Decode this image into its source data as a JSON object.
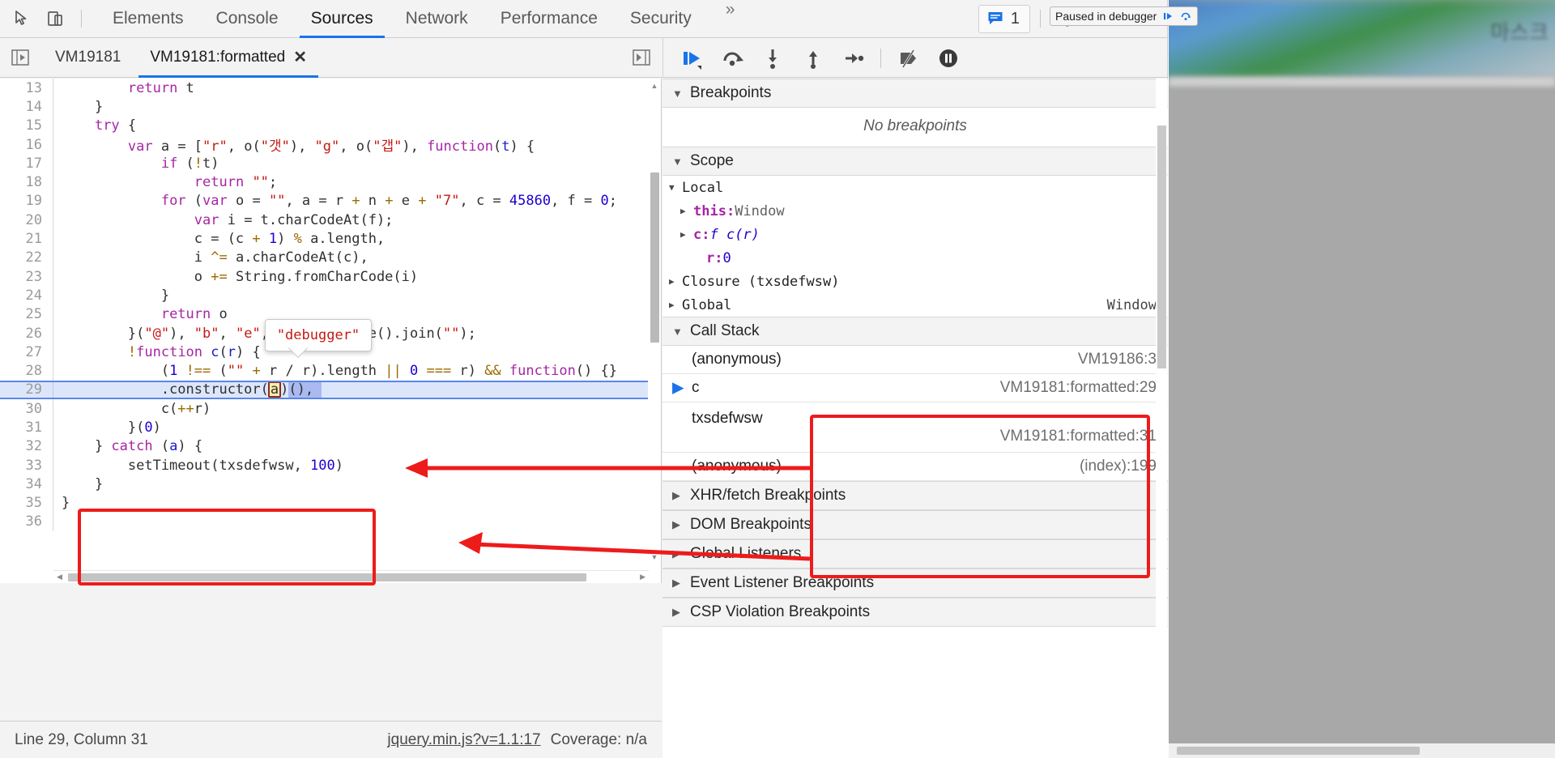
{
  "toolbar": {
    "icons": {
      "inspect": "inspect-cursor-icon",
      "device": "device-toggle-icon"
    },
    "tabs": [
      {
        "label": "Elements",
        "active": false
      },
      {
        "label": "Console",
        "active": false
      },
      {
        "label": "Sources",
        "active": true
      },
      {
        "label": "Network",
        "active": false
      },
      {
        "label": "Performance",
        "active": false
      },
      {
        "label": "Security",
        "active": false
      }
    ],
    "overflow_label": "»",
    "message_count": "1",
    "settings_icon": "gear-icon",
    "more_icon": "kebab-menu-icon",
    "close_icon": "close-icon"
  },
  "sources": {
    "file_tabs": [
      {
        "label": "VM19181",
        "active": false,
        "closable": false
      },
      {
        "label": "VM19181:formatted",
        "active": true,
        "closable": true,
        "close_label": "✕"
      }
    ],
    "debugger_buttons": [
      {
        "name": "resume-script-execution",
        "title": "Resume script execution"
      },
      {
        "name": "step-over-next-function-call",
        "title": "Step over next function call"
      },
      {
        "name": "step-into-next-function-call",
        "title": "Step into next function call"
      },
      {
        "name": "step-out-of-current-function",
        "title": "Step out of current function"
      },
      {
        "name": "step",
        "title": "Step"
      },
      {
        "name": "deactivate-breakpoints",
        "title": "Deactivate breakpoints"
      },
      {
        "name": "pause-on-exceptions",
        "title": "Pause on exceptions"
      }
    ]
  },
  "editor": {
    "highlighted_line": 29,
    "tooltip_text": "\"debugger\"",
    "lines": [
      {
        "n": "13",
        "tokens": [
          {
            "t": "plain",
            "v": "        "
          },
          {
            "t": "kw",
            "v": "return"
          },
          {
            "t": "plain",
            "v": " t"
          }
        ]
      },
      {
        "n": "14",
        "tokens": [
          {
            "t": "plain",
            "v": "    }"
          }
        ]
      },
      {
        "n": "15",
        "tokens": [
          {
            "t": "plain",
            "v": "    "
          },
          {
            "t": "kw",
            "v": "try"
          },
          {
            "t": "plain",
            "v": " {"
          }
        ]
      },
      {
        "n": "16",
        "tokens": [
          {
            "t": "plain",
            "v": "        "
          },
          {
            "t": "kw",
            "v": "var"
          },
          {
            "t": "plain",
            "v": " a = ["
          },
          {
            "t": "str",
            "v": "\"r\""
          },
          {
            "t": "plain",
            "v": ", o("
          },
          {
            "t": "str",
            "v": "\"갯\""
          },
          {
            "t": "plain",
            "v": "), "
          },
          {
            "t": "str",
            "v": "\"g\""
          },
          {
            "t": "plain",
            "v": ", o("
          },
          {
            "t": "str",
            "v": "\"갭\""
          },
          {
            "t": "plain",
            "v": "), "
          },
          {
            "t": "kw",
            "v": "function"
          },
          {
            "t": "plain",
            "v": "("
          },
          {
            "t": "id",
            "v": "t"
          },
          {
            "t": "plain",
            "v": ") {"
          }
        ]
      },
      {
        "n": "17",
        "tokens": [
          {
            "t": "plain",
            "v": "            "
          },
          {
            "t": "kw",
            "v": "if"
          },
          {
            "t": "plain",
            "v": " ("
          },
          {
            "t": "op",
            "v": "!"
          },
          {
            "t": "plain",
            "v": "t)"
          }
        ]
      },
      {
        "n": "18",
        "tokens": [
          {
            "t": "plain",
            "v": "                "
          },
          {
            "t": "kw",
            "v": "return"
          },
          {
            "t": "plain",
            "v": " "
          },
          {
            "t": "str",
            "v": "\"\""
          },
          {
            "t": "plain",
            "v": ";"
          }
        ]
      },
      {
        "n": "19",
        "tokens": [
          {
            "t": "plain",
            "v": "            "
          },
          {
            "t": "kw",
            "v": "for"
          },
          {
            "t": "plain",
            "v": " ("
          },
          {
            "t": "kw",
            "v": "var"
          },
          {
            "t": "plain",
            "v": " o = "
          },
          {
            "t": "str",
            "v": "\"\""
          },
          {
            "t": "plain",
            "v": ", a = r "
          },
          {
            "t": "op",
            "v": "+"
          },
          {
            "t": "plain",
            "v": " n "
          },
          {
            "t": "op",
            "v": "+"
          },
          {
            "t": "plain",
            "v": " e "
          },
          {
            "t": "op",
            "v": "+"
          },
          {
            "t": "plain",
            "v": " "
          },
          {
            "t": "str",
            "v": "\"7\""
          },
          {
            "t": "plain",
            "v": ", c = "
          },
          {
            "t": "num",
            "v": "45860"
          },
          {
            "t": "plain",
            "v": ", f = "
          },
          {
            "t": "num",
            "v": "0"
          },
          {
            "t": "plain",
            "v": ";"
          }
        ]
      },
      {
        "n": "20",
        "tokens": [
          {
            "t": "plain",
            "v": "                "
          },
          {
            "t": "kw",
            "v": "var"
          },
          {
            "t": "plain",
            "v": " i = t.charCodeAt(f);"
          }
        ]
      },
      {
        "n": "21",
        "tokens": [
          {
            "t": "plain",
            "v": "                c = (c "
          },
          {
            "t": "op",
            "v": "+"
          },
          {
            "t": "plain",
            "v": " "
          },
          {
            "t": "num",
            "v": "1"
          },
          {
            "t": "plain",
            "v": ") "
          },
          {
            "t": "op",
            "v": "%"
          },
          {
            "t": "plain",
            "v": " a.length,"
          }
        ]
      },
      {
        "n": "22",
        "tokens": [
          {
            "t": "plain",
            "v": "                i "
          },
          {
            "t": "op",
            "v": "^="
          },
          {
            "t": "plain",
            "v": " a.charCodeAt(c),"
          }
        ]
      },
      {
        "n": "23",
        "tokens": [
          {
            "t": "plain",
            "v": "                o "
          },
          {
            "t": "op",
            "v": "+="
          },
          {
            "t": "plain",
            "v": " String.fromCharCode(i)"
          }
        ]
      },
      {
        "n": "24",
        "tokens": [
          {
            "t": "plain",
            "v": "            }"
          }
        ]
      },
      {
        "n": "25",
        "tokens": [
          {
            "t": "plain",
            "v": "            "
          },
          {
            "t": "kw",
            "v": "return"
          },
          {
            "t": "plain",
            "v": " o"
          }
        ]
      },
      {
        "n": "26",
        "tokens": [
          {
            "t": "plain",
            "v": "        }("
          },
          {
            "t": "str",
            "v": "\"@\""
          },
          {
            "t": "plain",
            "v": "), "
          },
          {
            "t": "str",
            "v": "\"b\""
          },
          {
            "t": "plain",
            "v": ", "
          },
          {
            "t": "str",
            "v": "\"e\""
          },
          {
            "t": "plain",
            "v": ", "
          },
          {
            "t": "str",
            "v": "\"d\""
          },
          {
            "t": "plain",
            "v": "].reverse().join("
          },
          {
            "t": "str",
            "v": "\"\""
          },
          {
            "t": "plain",
            "v": ");"
          }
        ]
      },
      {
        "n": "27",
        "tokens": [
          {
            "t": "plain",
            "v": "        "
          },
          {
            "t": "op",
            "v": "!"
          },
          {
            "t": "kw",
            "v": "function"
          },
          {
            "t": "plain",
            "v": " "
          },
          {
            "t": "id",
            "v": "c"
          },
          {
            "t": "plain",
            "v": "("
          },
          {
            "t": "id",
            "v": "r"
          },
          {
            "t": "plain",
            "v": ") {"
          }
        ]
      },
      {
        "n": "28",
        "tokens": [
          {
            "t": "plain",
            "v": "            ("
          },
          {
            "t": "num",
            "v": "1"
          },
          {
            "t": "plain",
            "v": " "
          },
          {
            "t": "op",
            "v": "!=="
          },
          {
            "t": "plain",
            "v": " ("
          },
          {
            "t": "str",
            "v": "\"\""
          },
          {
            "t": "plain",
            "v": " "
          },
          {
            "t": "op",
            "v": "+"
          },
          {
            "t": "plain",
            "v": " r / r).length "
          },
          {
            "t": "op",
            "v": "||"
          },
          {
            "t": "plain",
            "v": " "
          },
          {
            "t": "num",
            "v": "0"
          },
          {
            "t": "plain",
            "v": " "
          },
          {
            "t": "op",
            "v": "==="
          },
          {
            "t": "plain",
            "v": " r) "
          },
          {
            "t": "op",
            "v": "&&"
          },
          {
            "t": "plain",
            "v": " "
          },
          {
            "t": "kw",
            "v": "function"
          },
          {
            "t": "plain",
            "v": "() {}"
          }
        ]
      },
      {
        "n": "29",
        "tokens": [
          {
            "t": "plain",
            "v": "            .constructor("
          },
          {
            "t": "varbox",
            "v": "a"
          },
          {
            "t": "plain",
            "v": ")"
          },
          {
            "t": "sel",
            "v": "(), "
          }
        ]
      },
      {
        "n": "30",
        "tokens": [
          {
            "t": "plain",
            "v": "            c("
          },
          {
            "t": "op",
            "v": "++"
          },
          {
            "t": "plain",
            "v": "r)"
          }
        ]
      },
      {
        "n": "31",
        "tokens": [
          {
            "t": "plain",
            "v": "        }("
          },
          {
            "t": "num",
            "v": "0"
          },
          {
            "t": "plain",
            "v": ")"
          }
        ]
      },
      {
        "n": "32",
        "tokens": [
          {
            "t": "plain",
            "v": "    } "
          },
          {
            "t": "kw",
            "v": "catch"
          },
          {
            "t": "plain",
            "v": " ("
          },
          {
            "t": "id",
            "v": "a"
          },
          {
            "t": "plain",
            "v": ") {"
          }
        ]
      },
      {
        "n": "33",
        "tokens": [
          {
            "t": "plain",
            "v": "        setTimeout(txsdefwsw, "
          },
          {
            "t": "num",
            "v": "100"
          },
          {
            "t": "plain",
            "v": ")"
          }
        ]
      },
      {
        "n": "34",
        "tokens": [
          {
            "t": "plain",
            "v": "    }"
          }
        ]
      },
      {
        "n": "35",
        "tokens": [
          {
            "t": "plain",
            "v": "}"
          }
        ]
      },
      {
        "n": "36",
        "tokens": [
          {
            "t": "plain",
            "v": ""
          }
        ]
      }
    ]
  },
  "sidebar": {
    "breakpoints": {
      "title": "Breakpoints",
      "empty_text": "No breakpoints"
    },
    "scope": {
      "title": "Scope",
      "rows": [
        {
          "indent": 0,
          "twisty": "▼",
          "name": "Local",
          "value": "",
          "right": ""
        },
        {
          "indent": 1,
          "twisty": "▶",
          "name": "this:",
          "value": " Window",
          "right": ""
        },
        {
          "indent": 1,
          "twisty": "▶",
          "name": "c:",
          "value": " f c(r)",
          "right": ""
        },
        {
          "indent": 2,
          "twisty": "",
          "name": "r:",
          "value": " 0",
          "right": ""
        },
        {
          "indent": 0,
          "twisty": "▶",
          "name": "Closure (txsdefwsw)",
          "value": "",
          "right": ""
        },
        {
          "indent": 0,
          "twisty": "▶",
          "name": "Global",
          "value": "",
          "right": "Window"
        }
      ]
    },
    "call_stack": {
      "title": "Call Stack",
      "frames": [
        {
          "name": "(anonymous)",
          "location": "VM19186:3",
          "selected": false,
          "wrap": false
        },
        {
          "name": "c",
          "location": "VM19181:formatted:29",
          "selected": true,
          "wrap": false
        },
        {
          "name": "txsdefwsw",
          "location": "VM19181:formatted:31",
          "selected": false,
          "wrap": true
        },
        {
          "name": "(anonymous)",
          "location": "(index):199",
          "selected": false,
          "wrap": false
        }
      ]
    },
    "collapsed_panes": [
      {
        "title": "XHR/fetch Breakpoints"
      },
      {
        "title": "DOM Breakpoints"
      },
      {
        "title": "Global Listeners"
      },
      {
        "title": "Event Listener Breakpoints"
      },
      {
        "title": "CSP Violation Breakpoints"
      }
    ]
  },
  "status_bar": {
    "cursor": "Line 29, Column 31",
    "source_link": "jquery.min.js?v=1.1:17",
    "coverage": "Coverage: n/a"
  },
  "page_overlay": {
    "paused_text": "Paused in debugger",
    "resume_icon": "resume-icon",
    "step-over_icon": "step-over-icon"
  },
  "colors": {
    "accent": "#1a73e8",
    "annotation_red": "#ee1b1b",
    "highlight_row": "#dce6fb",
    "keyword": "#a626a4",
    "string": "#c41a16",
    "number": "#1c00cf"
  }
}
